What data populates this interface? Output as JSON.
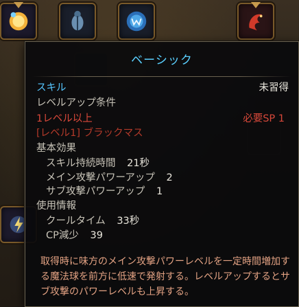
{
  "tooltip": {
    "title": "ベーシック",
    "skill_label": "スキル",
    "status": "未習得",
    "requirements_heading": "レベルアップ条件",
    "req_level": "1レベル以上",
    "req_sp": "必要SP 1",
    "req_skill": "[レベル1] ブラックマス",
    "basic_effects_heading": "基本効果",
    "effects": [
      {
        "name": "スキル持続時間",
        "value": "21秒"
      },
      {
        "name": "メイン攻撃パワーアップ",
        "value": "2"
      },
      {
        "name": "サブ攻撃パワーアップ",
        "value": "1"
      }
    ],
    "usage_heading": "使用情報",
    "usage": [
      {
        "name": "クールタイム",
        "value": "33秒"
      },
      {
        "name": "CP減少",
        "value": "39"
      }
    ],
    "description": "取得時に味方のメイン攻撃パワーレベルを一定時間増加する魔法球を前方に低速で発射する。レベルアップするとサブ攻撃のパワーレベルも上昇する。"
  },
  "background": {
    "icons": [
      "fire-orb-icon",
      "beetle-icon",
      "shield-w-icon",
      "red-dragon-icon",
      "lightning-orb-icon"
    ]
  },
  "colors": {
    "accent_blue": "#56c6ff",
    "requirement_red": "#d9483a",
    "description_orange": "#e3a283"
  }
}
